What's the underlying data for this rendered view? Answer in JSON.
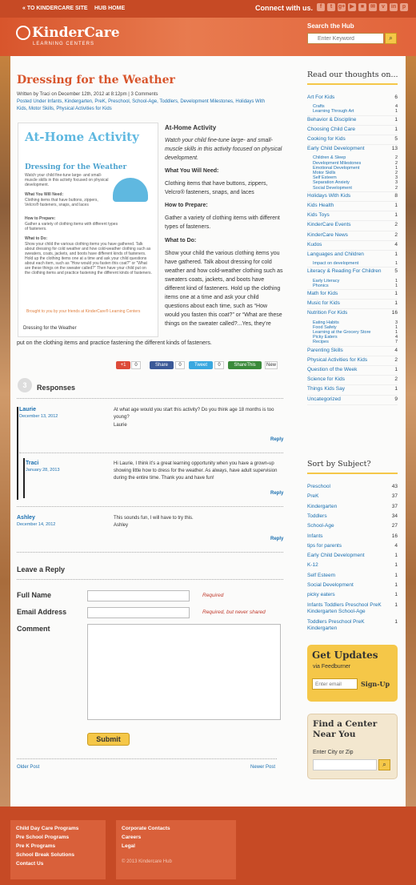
{
  "topbar": {
    "kinder_site": "« TO KINDERCARE SITE",
    "hub_home": "HUB HOME",
    "connect": "Connect with us.",
    "social": [
      "f",
      "t",
      "g+",
      "▶",
      "■",
      "✉",
      "v",
      "in",
      "p",
      "rss"
    ]
  },
  "brand": {
    "name": "KinderCare",
    "sub": "LEARNING CENTERS"
  },
  "search": {
    "label": "Search the Hub",
    "placeholder": "Enter Keyword"
  },
  "post": {
    "title": "Dressing for the Weather",
    "meta1": "Written by Traci on December 12th, 2012 at 8:12pm | 3 Comments",
    "meta2": "Posted Under Infants, Kindergarten, PreK, Preschool, School-Age, Toddlers, Development Milestones, Holidays With",
    "meta3": "Kids, Motor Skills, Physical Activities for Kids",
    "img": {
      "heading": "At-Home Activity",
      "h2": "Dressing for the Weather",
      "intro": "Watch your child fine-tune large- and small-muscle skills in this activity focused on physical development.",
      "need_h": "What You Will Need:",
      "need": "Clothing items that have buttons, zippers, Velcro® fasteners, snaps, and laces",
      "prep_h": "How to Prepare:",
      "prep": "Gather a variety of clothing items with different types of fasteners.",
      "do_h": "What to Do:",
      "do": "Show your child the various clothing items you have gathered. Talk about dressing for cold weather and how cold-weather clothing such as sweaters, coats, jackets, and boots have different kinds of fasteners. Hold up the clothing items one at a time and ask your child questions about each item, such as \"How would you fasten this coat?\" or \"What are these things on the sweater called?\" Then have your child put on the clothing items and practice fastening the different kinds of fasteners.",
      "credit": "Brought to you by your friends at KinderCare® Learning Centers",
      "caption": "Dressing for the Weather"
    },
    "activity_title": "At-Home Activity",
    "intro": "Watch your child fine-tune large- and small-muscle skills in this activity focused on physical development.",
    "need_h": "What You Will Need:",
    "need": "Clothing items that have buttons, zippers, Velcro® fasteners, snaps, and laces",
    "prep_h": "How to Prepare:",
    "prep": "Gather a variety of clothing items with different types of fasteners.",
    "do_h": "What to Do:",
    "do": "Show your child the various clothing items you have gathered. Talk about dressing for cold weather and how cold-weather clothing such as sweaters coats, jackets, and boots have different kind of fasteners. Hold up the clothing items one at a time and ask your child questions about each time, such as “How would you fasten this coat?” or “What are these things on the sweater called?...Yes, they’re called snaps.” Then have your child put on the clothing items and practice fastening the different kinds of fasteners."
  },
  "share": {
    "gplus": "+1",
    "gplus_count": "0",
    "fb": "Share",
    "fb_count": "0",
    "tw": "Tweet",
    "tw_count": "0",
    "sharethis": "ShareThis",
    "new": "New"
  },
  "responses": {
    "count": "3",
    "title": "Responses",
    "items": [
      {
        "name": "Laurie",
        "date": "December 13, 2012",
        "text": "At what age would you start this activity? Do you think age 18 months is too young?",
        "sig": "Laurie",
        "reply": "Reply"
      },
      {
        "name": "Traci",
        "date": "January 28, 2013",
        "text": "Hi Laurie, I think it’s a great learning opportunity when you have a grown-up showing little how to dress for the weather. As always, have adult supervision during the entire time. Thank you and have fun!",
        "reply": "Reply"
      },
      {
        "name": "Ashley",
        "date": "December 14, 2012",
        "text": "This sounds fun, I will have to try this.",
        "sig": "Ashley",
        "reply": "Reply"
      }
    ]
  },
  "form": {
    "title": "Leave a Reply",
    "name_label": "Full Name",
    "email_label": "Email Address",
    "comment_label": "Comment",
    "req": "Required",
    "req_email": "Required, but never shared",
    "submit": "Submit"
  },
  "pager": {
    "older": "Older Post",
    "newer": "Newer Post"
  },
  "sidebar": {
    "thoughts_title": "Read our thoughts on...",
    "subject_title": "Sort by Subject?",
    "thoughts": [
      {
        "label": "Art For Kids",
        "count": "6",
        "subs": [
          {
            "label": "Crafts",
            "count": "4"
          },
          {
            "label": "Learning Through Art",
            "count": "1"
          }
        ]
      },
      {
        "label": "Behavior & Discipline",
        "count": "1"
      },
      {
        "label": "Choosing Child Care",
        "count": "1"
      },
      {
        "label": "Cooking for Kids",
        "count": "5"
      },
      {
        "label": "Early Child Development",
        "count": "13",
        "subs": [
          {
            "label": "Children & Sleep",
            "count": "2"
          },
          {
            "label": "Development Milestones",
            "count": "2"
          },
          {
            "label": "Emotional Development",
            "count": "1"
          },
          {
            "label": "Motor Skills",
            "count": "2"
          },
          {
            "label": "Self Esteem",
            "count": "3"
          },
          {
            "label": "Separation Anxiety",
            "count": "3"
          },
          {
            "label": "Social Development",
            "count": "2"
          }
        ]
      },
      {
        "label": "Holidays With Kids",
        "count": "8"
      },
      {
        "label": "Kids Health",
        "count": "1"
      },
      {
        "label": "Kids Toys",
        "count": "1"
      },
      {
        "label": "KinderCare Events",
        "count": "2"
      },
      {
        "label": "KinderCare News",
        "count": "2"
      },
      {
        "label": "Kudos",
        "count": "4"
      },
      {
        "label": "Languages and Children",
        "count": "1",
        "subs": [
          {
            "label": "Impact on development",
            "count": "1"
          }
        ]
      },
      {
        "label": "Literacy & Reading For Children",
        "count": "5",
        "subs": [
          {
            "label": "Early Literacy",
            "count": "1"
          },
          {
            "label": "Phonics",
            "count": "1"
          }
        ]
      },
      {
        "label": "Math for Kids",
        "count": "1"
      },
      {
        "label": "Music for Kids",
        "count": "1"
      },
      {
        "label": "Nutrition For Kids",
        "count": "16",
        "subs": [
          {
            "label": "Eating Habits",
            "count": "3"
          },
          {
            "label": "Food Safety",
            "count": "1"
          },
          {
            "label": "Learning at the Grocery Store",
            "count": "1"
          },
          {
            "label": "Picky Eaters",
            "count": "4"
          },
          {
            "label": "Recipes",
            "count": "7"
          }
        ]
      },
      {
        "label": "Parenting Skills",
        "count": "4"
      },
      {
        "label": "Physical Activities for Kids",
        "count": "2"
      },
      {
        "label": "Question of the Week",
        "count": "1"
      },
      {
        "label": "Science for Kids",
        "count": "2"
      },
      {
        "label": "Things Kids Say",
        "count": "1"
      },
      {
        "label": "Uncategorized",
        "count": "9"
      }
    ],
    "subjects": [
      {
        "label": "Preschool",
        "count": "43"
      },
      {
        "label": "PreK",
        "count": "37"
      },
      {
        "label": "Kindergarten",
        "count": "37"
      },
      {
        "label": "Toddlers",
        "count": "34"
      },
      {
        "label": "School-Age",
        "count": "27"
      },
      {
        "label": "Infants",
        "count": "16"
      },
      {
        "label": "tips for parents",
        "count": "4"
      },
      {
        "label": "Early Child Development",
        "count": "1"
      },
      {
        "label": "K-12",
        "count": "1"
      },
      {
        "label": "Self Esteem",
        "count": "1"
      },
      {
        "label": "Social Development",
        "count": "1"
      },
      {
        "label": "picky eaters",
        "count": "1"
      },
      {
        "label": "Infants Toddlers Preschool PreK Kindergarten School-Age",
        "count": "1"
      },
      {
        "label": "Toddlers Preschool PreK Kindergarten",
        "count": "1"
      }
    ],
    "updates": {
      "title": "Get Updates",
      "via": "via Feedburner",
      "placeholder": "Enter email",
      "btn": "Sign-Up"
    },
    "find": {
      "title": "Find a Center Near You",
      "label": "Enter City or Zip"
    }
  },
  "footer": {
    "col1": [
      "Child Day Care Programs",
      "Pre School Programs",
      "Pre K Programs",
      "School Break Solutions",
      "Contact Us"
    ],
    "col2": [
      "Corporate Contacts",
      "Careers",
      "Legal"
    ],
    "copy": "© 2013 Kindercare Hub"
  },
  "colors": {
    "brand": "#c64a25",
    "accent": "#f5c748",
    "link": "#1a6fb0",
    "title": "#d8552c"
  }
}
